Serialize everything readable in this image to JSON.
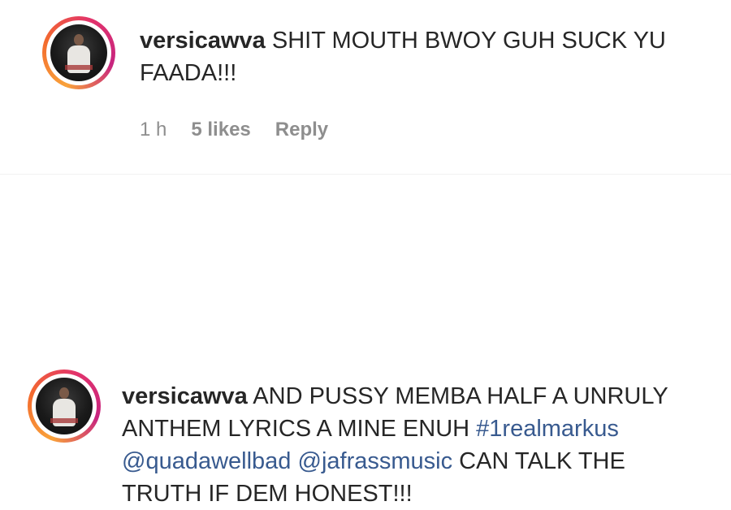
{
  "comments": [
    {
      "username": "versicawva",
      "text": "SHIT MOUTH BWOY GUH SUCK YU FAADA!!!",
      "time": "1 h",
      "likes": "5 likes",
      "reply": "Reply"
    },
    {
      "username": "versicawva",
      "text_part1": "AND PUSSY MEMBA HALF A UNRULY ANTHEM LYRICS A MINE ENUH",
      "hashtag": "#1realmarkus",
      "mention1": "@quadawellbad",
      "mention2": "@jafrassmusic",
      "text_part2": "CAN TALK THE TRUTH IF DEM HONEST!!!"
    }
  ],
  "colors": {
    "link": "#385a8f",
    "meta": "#8e8e8e",
    "text": "#262626"
  }
}
